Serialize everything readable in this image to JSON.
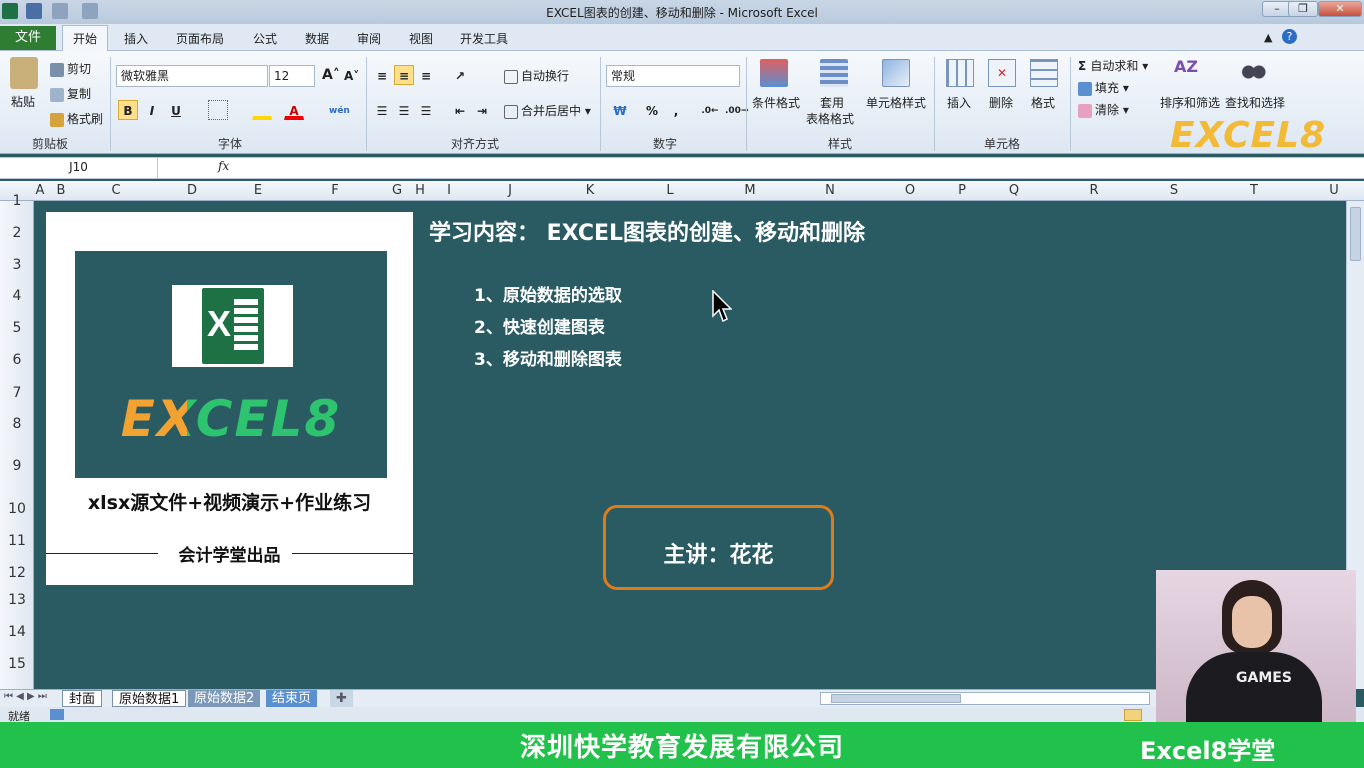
{
  "window": {
    "title": "EXCEL图表的创建、移动和删除 - Microsoft Excel"
  },
  "tabs": [
    "文件",
    "开始",
    "插入",
    "页面布局",
    "公式",
    "数据",
    "审阅",
    "视图",
    "开发工具"
  ],
  "clipboard": {
    "paste": "粘贴",
    "cut": "剪切",
    "copy": "复制",
    "format_painter": "格式刷",
    "label": "剪贴板"
  },
  "font": {
    "name": "微软雅黑",
    "size": "12",
    "label": "字体",
    "bold": "B",
    "italic": "I",
    "underline": "U"
  },
  "alignment": {
    "wrap": "自动换行",
    "merge": "合并后居中",
    "label": "对齐方式"
  },
  "number": {
    "format": "常规",
    "label": "数字",
    "percent": "%",
    "comma": ","
  },
  "styles": {
    "conditional": "条件格式",
    "table1": "套用",
    "table2": "表格格式",
    "cell_styles": "单元格样式",
    "label": "样式"
  },
  "cells": {
    "insert": "插入",
    "delete": "删除",
    "format": "格式",
    "label": "单元格"
  },
  "editing": {
    "autosum": "自动求和",
    "fill": "填充",
    "clear": "清除",
    "sort": "排序和筛选",
    "find": "查找和选择"
  },
  "brand_watermark": "EXCEL8",
  "namebox": "J10",
  "fx": "fx",
  "columns": [
    "A",
    "B",
    "C",
    "D",
    "E",
    "F",
    "G",
    "H",
    "I",
    "J",
    "K",
    "L",
    "M",
    "N",
    "O",
    "P",
    "Q",
    "R",
    "S",
    "T",
    "U"
  ],
  "rows": [
    "1",
    "2",
    "3",
    "4",
    "5",
    "6",
    "7",
    "8",
    "9",
    "10",
    "11",
    "12",
    "13",
    "14",
    "15"
  ],
  "card": {
    "logo_text": "EXCEL8",
    "subtitle": "xlsx源文件+视频演示+作业练习",
    "footer": "会计学堂出品"
  },
  "content": {
    "heading": "学习内容： EXCEL图表的创建、移动和删除",
    "items": [
      "1、原始数据的选取",
      "2、快速创建图表",
      "3、移动和删除图表"
    ],
    "presenter": "主讲：花花"
  },
  "sheet_tabs": [
    "封面",
    "原始数据1",
    "原始数据2",
    "结束页"
  ],
  "status": "就绪",
  "banner": {
    "center": "深圳快学教育发展有限公司",
    "right": "Excel8学堂"
  },
  "colors": {
    "sheet_bg": "#2a5b63",
    "accent_orange": "#e07b1a",
    "banner_green": "#21c14b",
    "excel_green": "#1e7145"
  }
}
